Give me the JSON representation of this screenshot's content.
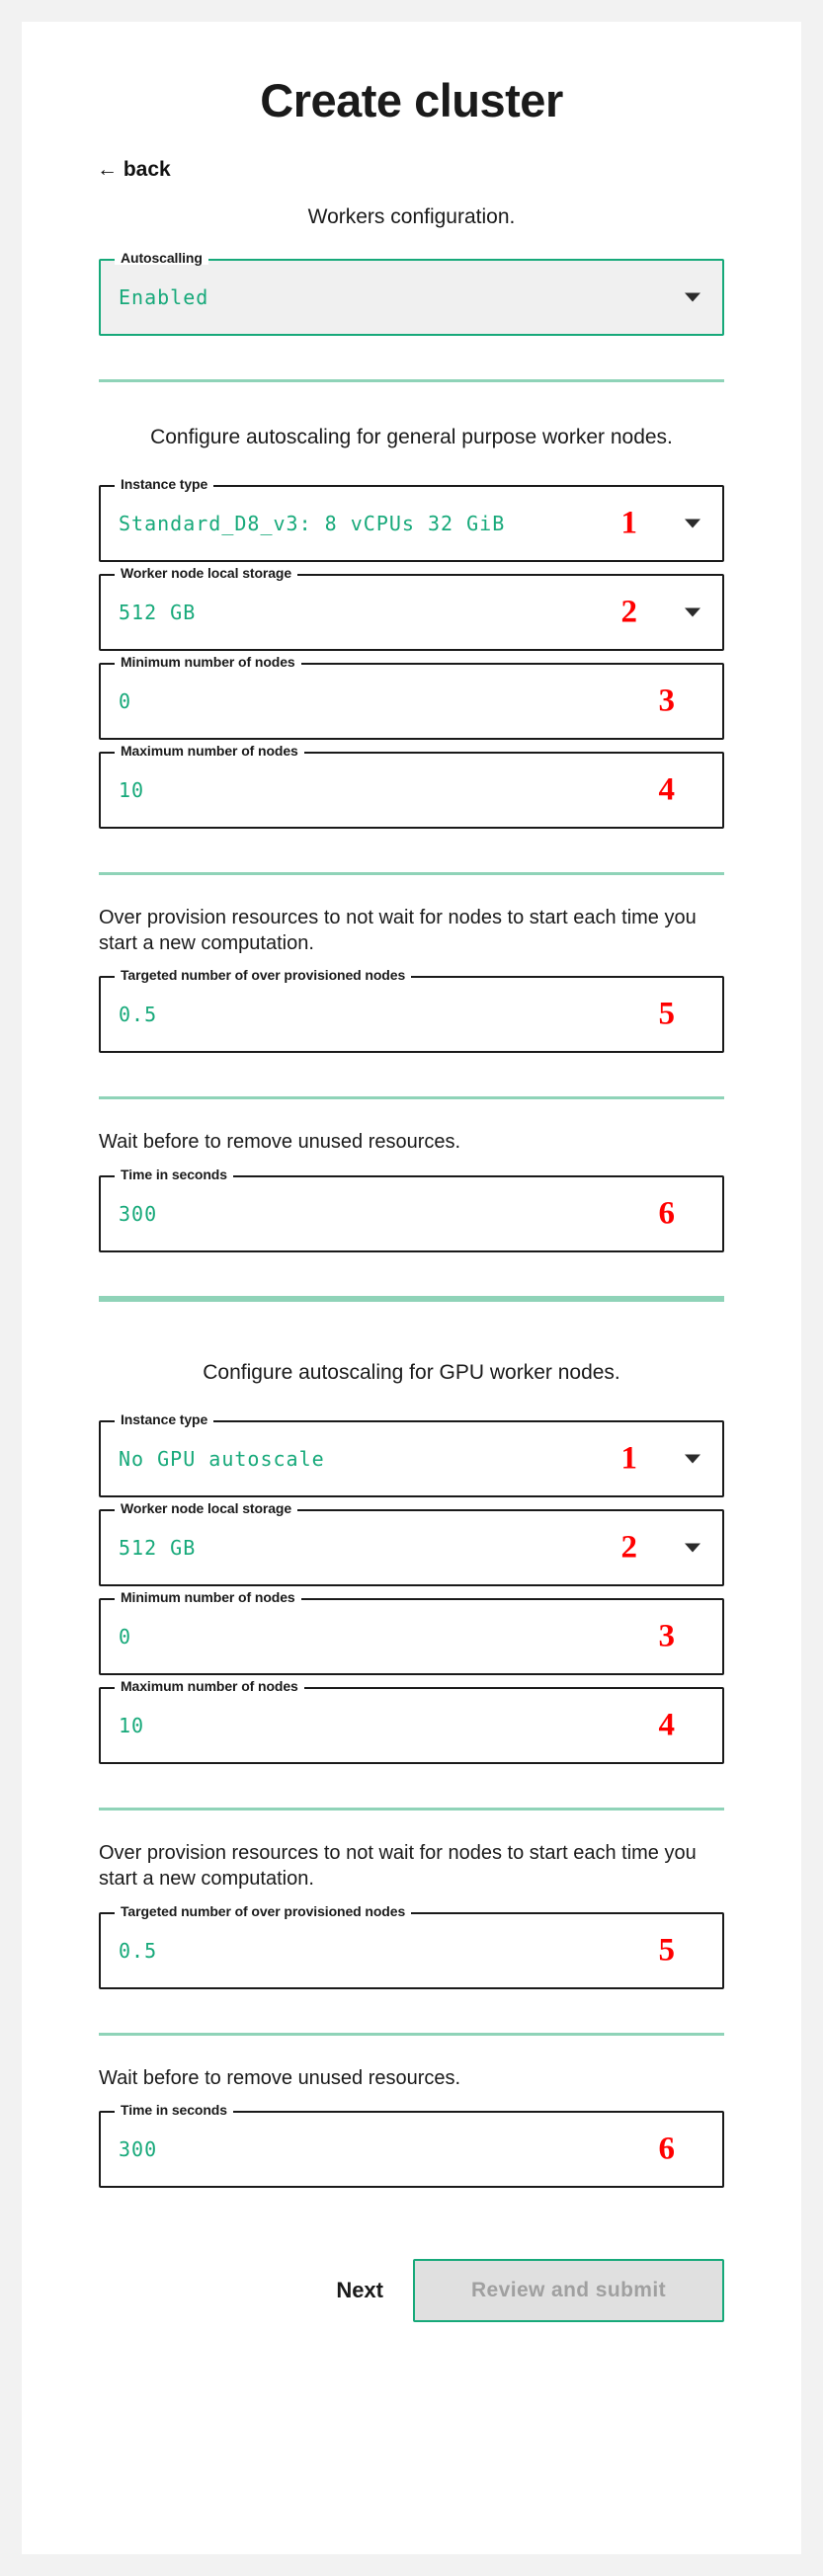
{
  "colors": {
    "accent_green": "#17a97a",
    "divider_green": "#8fd3b8",
    "marker_red": "#ff0000",
    "page_bg": "#f2f2f2",
    "card_bg": "#ffffff",
    "disabled_btn_bg": "#e0e0e0"
  },
  "header": {
    "title": "Create cluster",
    "back_label": "← back",
    "subtitle": "Workers configuration."
  },
  "autoscaling": {
    "legend": "Autoscalling",
    "value": "Enabled",
    "caret_icon": "chevron-down-icon"
  },
  "general_section": {
    "caption": "Configure autoscaling for general purpose worker nodes.",
    "fields": [
      {
        "legend": "Instance type",
        "value": "Standard_D8_v3: 8 vCPUs 32 GiB",
        "marker": "1",
        "has_caret": true
      },
      {
        "legend": "Worker node local storage",
        "value": "512 GB",
        "marker": "2",
        "has_caret": true
      },
      {
        "legend": "Minimum number of nodes",
        "value": "0",
        "marker": "3",
        "has_caret": false
      },
      {
        "legend": "Maximum number of nodes",
        "value": "10",
        "marker": "4",
        "has_caret": false
      }
    ],
    "overprovision_text": "Over provision resources to not wait for nodes to start each time you start a new computation.",
    "overprovision_field": {
      "legend": "Targeted number of over provisioned nodes",
      "value": "0.5",
      "marker": "5",
      "has_caret": false
    },
    "wait_text": "Wait before to remove unused resources.",
    "wait_field": {
      "legend": "Time in seconds",
      "value": "300",
      "marker": "6",
      "has_caret": false
    }
  },
  "gpu_section": {
    "caption": "Configure autoscaling for GPU worker nodes.",
    "fields": [
      {
        "legend": "Instance type",
        "value": "No GPU autoscale",
        "marker": "1",
        "has_caret": true
      },
      {
        "legend": "Worker node local storage",
        "value": "512 GB",
        "marker": "2",
        "has_caret": true
      },
      {
        "legend": "Minimum number of nodes",
        "value": "0",
        "marker": "3",
        "has_caret": false
      },
      {
        "legend": "Maximum number of nodes",
        "value": "10",
        "marker": "4",
        "has_caret": false
      }
    ],
    "overprovision_text": "Over provision resources to not wait for nodes to start each time you start a new computation.",
    "overprovision_field": {
      "legend": "Targeted number of over provisioned nodes",
      "value": "0.5",
      "marker": "5",
      "has_caret": false
    },
    "wait_text": "Wait before to remove unused resources.",
    "wait_field": {
      "legend": "Time in seconds",
      "value": "300",
      "marker": "6",
      "has_caret": false
    }
  },
  "footer": {
    "next_label": "Next",
    "submit_label": "Review and submit"
  }
}
